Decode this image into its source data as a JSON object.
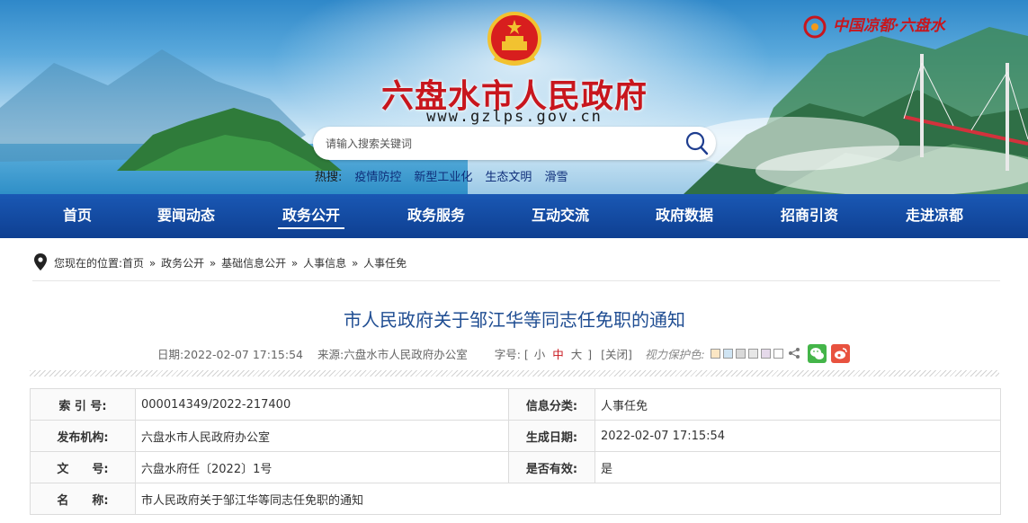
{
  "header": {
    "site_title": "六盘水市人民政府",
    "site_url": "www.gzlps.gov.cn",
    "brand_text": "中国凉都·六盘水",
    "search": {
      "placeholder": "请输入搜索关键词"
    },
    "hot": {
      "label": "热搜:",
      "items": [
        "疫情防控",
        "新型工业化",
        "生态文明",
        "滑雪"
      ]
    }
  },
  "nav": {
    "active_index": 2,
    "items": [
      "首页",
      "要闻动态",
      "政务公开",
      "政务服务",
      "互动交流",
      "政府数据",
      "招商引资",
      "走进凉都"
    ]
  },
  "breadcrumb": {
    "prefix": "您现在的位置:",
    "items": [
      "首页",
      "政务公开",
      "基础信息公开",
      "人事信息",
      "人事任免"
    ],
    "separator": "»"
  },
  "article": {
    "title": "市人民政府关于邹江华等同志任免职的通知",
    "date": "日期:2022-02-07 17:15:54",
    "source": "来源:六盘水市人民政府办公室",
    "font_size": {
      "label": "字号:",
      "open": "[",
      "small": "小",
      "medium": "中",
      "large": "大",
      "close": "]"
    },
    "close_label": "[关闭]",
    "eye_care_label": "视力保护色:",
    "eye_care_colors": [
      "#fbe6c4",
      "#cfe4f3",
      "#d9d9d9",
      "#e7e7e7",
      "#e5d9ea",
      "#ffffff"
    ]
  },
  "info_table": {
    "rows": [
      {
        "k1": "索 引 号:",
        "v1": "000014349/2022-217400",
        "k2": "信息分类:",
        "v2": "人事任免"
      },
      {
        "k1": "发布机构:",
        "v1": "六盘水市人民政府办公室",
        "k2": "生成日期:",
        "v2": "2022-02-07 17:15:54"
      },
      {
        "k1": "文　　号:",
        "v1": "六盘水府任〔2022〕1号",
        "k2": "是否有效:",
        "v2": "是"
      }
    ],
    "name_row": {
      "k": "名　　称:",
      "v": "市人民政府关于邹江华等同志任免职的通知"
    }
  },
  "colors": {
    "nav_blue": "#0e3f91",
    "title_red": "#c8161d",
    "article_title_blue": "#1f4d92"
  }
}
